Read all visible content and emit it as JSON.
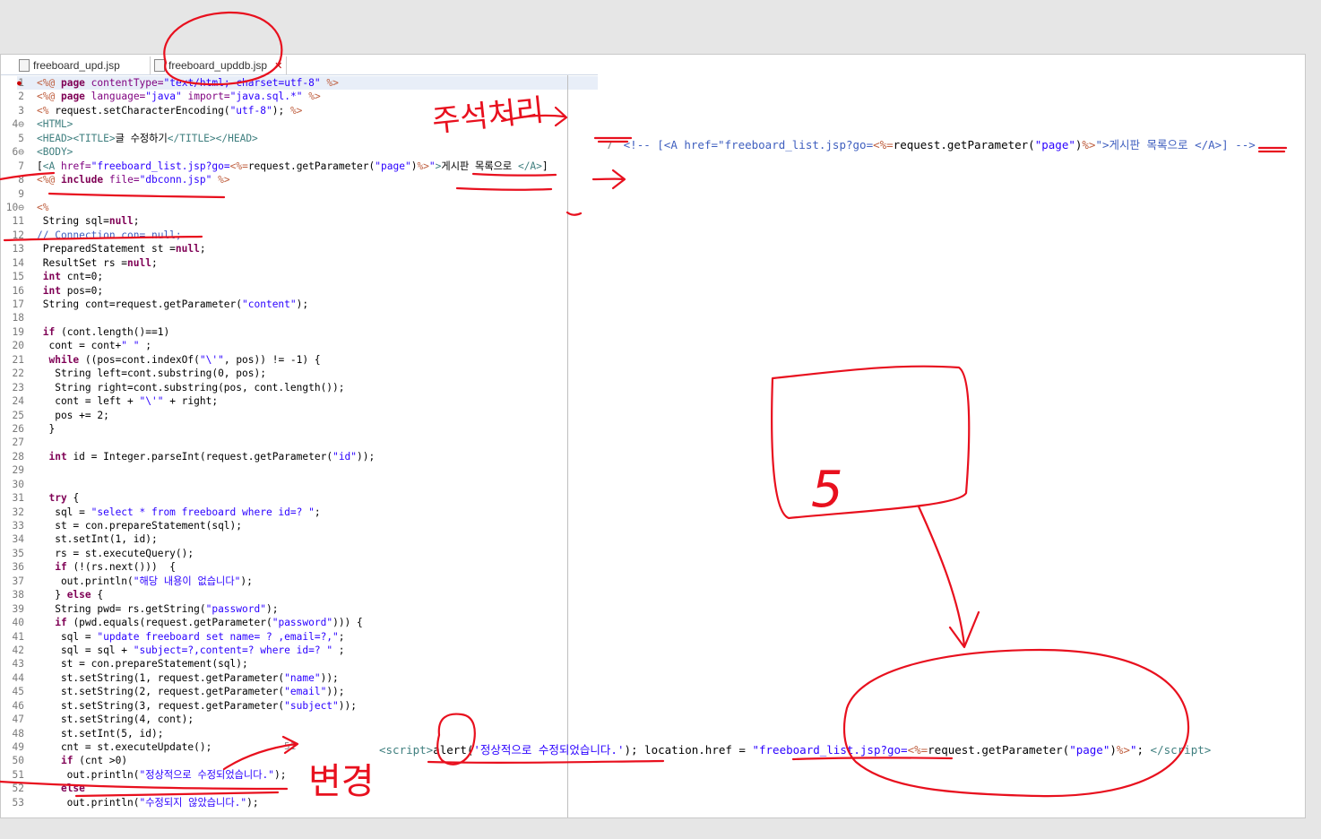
{
  "tabs": [
    {
      "label": "freeboard_upd.jsp"
    },
    {
      "label": "freeboard_upddb.jsp",
      "close": "✕"
    }
  ],
  "code_lines": [
    {
      "n": "1",
      "html": "<span class='jsp'>&lt;%@</span> <span class='kw'>page</span> <span class='attr'>contentType=</span><span class='str'>\"text/html; charset=utf-8\"</span> <span class='jsp'>%&gt;</span>"
    },
    {
      "n": "2",
      "html": "<span class='jsp'>&lt;%@</span> <span class='kw'>page</span> <span class='attr'>language=</span><span class='str'>\"java\"</span> <span class='attr'>import=</span><span class='str'>\"java.sql.*\"</span> <span class='jsp'>%&gt;</span>"
    },
    {
      "n": "3",
      "html": "<span class='jsp'>&lt;%</span> request.setCharacterEncoding(<span class='str'>\"utf-8\"</span>); <span class='jsp'>%&gt;</span>"
    },
    {
      "n": "4⊖",
      "html": "<span class='tag'>&lt;HTML&gt;</span>"
    },
    {
      "n": "5",
      "html": "<span class='tag'>&lt;HEAD&gt;&lt;TITLE&gt;</span>글 수정하기<span class='tag'>&lt;/TITLE&gt;&lt;/HEAD&gt;</span>"
    },
    {
      "n": "6⊖",
      "html": "<span class='tag'>&lt;BODY&gt;</span>"
    },
    {
      "n": "7",
      "html": "[<span class='tag'>&lt;A</span> <span class='attr'>href=</span><span class='str'>\"freeboard_list.jsp?go=</span><span class='jsp'>&lt;%=</span>request.getParameter(<span class='str'>\"page\"</span>)<span class='jsp'>%&gt;</span><span class='str'>\"</span><span class='tag'>&gt;</span>게시판 목록으로 <span class='tag'>&lt;/A&gt;</span>]"
    },
    {
      "n": "8",
      "html": "<span class='jsp'>&lt;%@</span> <span class='kw'>include</span> <span class='attr'>file=</span><span class='str'>\"dbconn.jsp\"</span> <span class='jsp'>%&gt;</span>"
    },
    {
      "n": "9",
      "html": ""
    },
    {
      "n": "10⊖",
      "html": "<span class='jsp'>&lt;%</span>"
    },
    {
      "n": "11",
      "html": " String sql=<span class='kw'>null</span>;"
    },
    {
      "n": "12",
      "html": "<span class='cmt'>// Connection con= null;</span>"
    },
    {
      "n": "13",
      "html": " PreparedStatement st =<span class='kw'>null</span>;"
    },
    {
      "n": "14",
      "html": " ResultSet rs =<span class='kw'>null</span>;"
    },
    {
      "n": "15",
      "html": " <span class='kw'>int</span> cnt=0;"
    },
    {
      "n": "16",
      "html": " <span class='kw'>int</span> pos=0;"
    },
    {
      "n": "17",
      "html": " String cont=request.getParameter(<span class='str'>\"content\"</span>);"
    },
    {
      "n": "18",
      "html": ""
    },
    {
      "n": "19",
      "html": " <span class='kw'>if</span> (cont.length()==1)"
    },
    {
      "n": "20",
      "html": "  cont = cont+<span class='str'>\" \"</span> ;"
    },
    {
      "n": "21",
      "html": "  <span class='kw'>while</span> ((pos=cont.indexOf(<span class='str'>\"\\'\"</span>, pos)) != -1) {"
    },
    {
      "n": "22",
      "html": "   String left=cont.substring(0, pos);"
    },
    {
      "n": "23",
      "html": "   String right=cont.substring(pos, cont.length());"
    },
    {
      "n": "24",
      "html": "   cont = left + <span class='str'>\"\\'\"</span> + right;"
    },
    {
      "n": "25",
      "html": "   pos += 2;"
    },
    {
      "n": "26",
      "html": "  }"
    },
    {
      "n": "27",
      "html": ""
    },
    {
      "n": "28",
      "html": "  <span class='kw'>int</span> id = Integer.parseInt(request.getParameter(<span class='str'>\"id\"</span>));"
    },
    {
      "n": "29",
      "html": ""
    },
    {
      "n": "30",
      "html": ""
    },
    {
      "n": "31",
      "html": "  <span class='kw'>try</span> {"
    },
    {
      "n": "32",
      "html": "   sql = <span class='str'>\"select * from freeboard where id=? \"</span>;"
    },
    {
      "n": "33",
      "html": "   st = con.prepareStatement(sql);"
    },
    {
      "n": "34",
      "html": "   st.setInt(1, id);"
    },
    {
      "n": "35",
      "html": "   rs = st.executeQuery();"
    },
    {
      "n": "36",
      "html": "   <span class='kw'>if</span> (!(rs.next()))  {"
    },
    {
      "n": "37",
      "html": "    out.println(<span class='str'>\"해당 내용이 없습니다\"</span>);"
    },
    {
      "n": "38",
      "html": "   } <span class='kw'>else</span> {"
    },
    {
      "n": "39",
      "html": "   String pwd= rs.getString(<span class='str'>\"password\"</span>);"
    },
    {
      "n": "40",
      "html": "   <span class='kw'>if</span> (pwd.equals(request.getParameter(<span class='str'>\"password\"</span>))) {"
    },
    {
      "n": "41",
      "html": "    sql = <span class='str'>\"update freeboard set name= ? ,email=?,\"</span>;"
    },
    {
      "n": "42",
      "html": "    sql = sql + <span class='str'>\"subject=?,content=? where id=? \"</span> ;"
    },
    {
      "n": "43",
      "html": "    st = con.prepareStatement(sql);"
    },
    {
      "n": "44",
      "html": "    st.setString(1, request.getParameter(<span class='str'>\"name\"</span>));"
    },
    {
      "n": "45",
      "html": "    st.setString(2, request.getParameter(<span class='str'>\"email\"</span>));"
    },
    {
      "n": "46",
      "html": "    st.setString(3, request.getParameter(<span class='str'>\"subject\"</span>));"
    },
    {
      "n": "47",
      "html": "    st.setString(4, cont);"
    },
    {
      "n": "48",
      "html": "    st.setInt(5, id);"
    },
    {
      "n": "49",
      "html": "    cnt = st.executeUpdate();"
    },
    {
      "n": "50",
      "html": "    <span class='kw'>if</span> (cnt &gt;0)"
    },
    {
      "n": "51",
      "html": "     out.println(<span class='str'>\"정상적으로 수정되었습니다.\"</span>);"
    },
    {
      "n": "52",
      "html": "    <span class='kw'>else</span>"
    },
    {
      "n": "53",
      "html": "     out.println(<span class='str'>\"수정되지 않았습니다.\"</span>);"
    }
  ],
  "right_line": {
    "num": "7",
    "html": "<span class='cmt'>&lt;!-- [&lt;A href=\"freeboard_list.jsp?go=</span><span class='jsp'>&lt;%=</span>request.getParameter(<span class='str'>\"page\"</span>)<span class='jsp'>%&gt;</span><span class='cmt'>\"&gt;게시판 목록으로 &lt;/A&gt;] --&gt;</span>"
  },
  "script_line": {
    "num": "51",
    "html": "<span class='tag'>&lt;script&gt;</span>alert(<span class='str'>'정상적으로 수정되었습니다.'</span>); location.href = <span class='str'>\"freeboard_list.jsp?go=</span><span class='jsp'>&lt;%=</span>request.getParameter(<span class='str'>\"page\"</span>)<span class='jsp'>%&gt;</span><span class='str'>\"</span>; <span class='tag'>&lt;/script&gt;</span>"
  },
  "annotations": {
    "comment_label": "주석처리",
    "change_label": "변경",
    "box_label": "5"
  },
  "colors": {
    "annotation": "#e8101e",
    "comment": "#3f5fbf",
    "keyword": "#7f0055",
    "string": "#2a00ff"
  }
}
